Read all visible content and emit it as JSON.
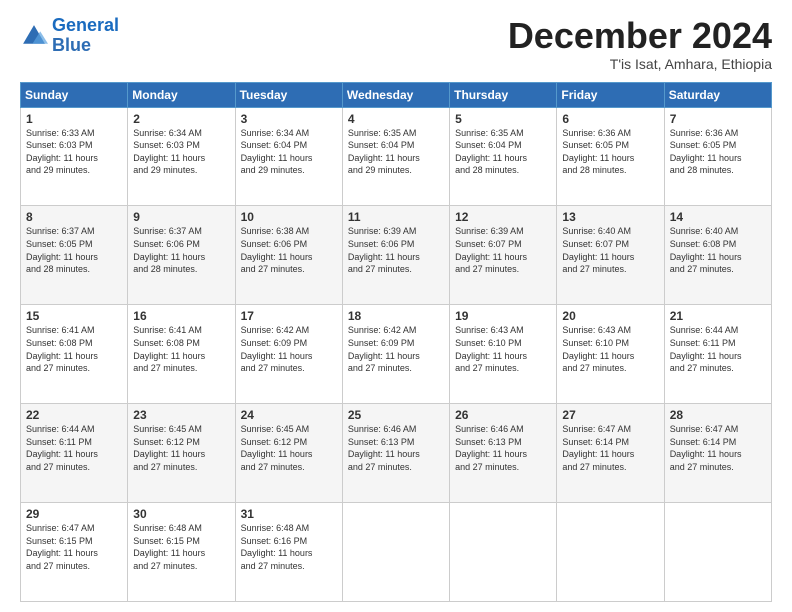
{
  "logo": {
    "line1": "General",
    "line2": "Blue"
  },
  "title": "December 2024",
  "subtitle": "T'is Isat, Amhara, Ethiopia",
  "days_of_week": [
    "Sunday",
    "Monday",
    "Tuesday",
    "Wednesday",
    "Thursday",
    "Friday",
    "Saturday"
  ],
  "weeks": [
    [
      {
        "day": "1",
        "rise": "6:33 AM",
        "set": "6:03 PM",
        "hours": "11",
        "mins": "29"
      },
      {
        "day": "2",
        "rise": "6:34 AM",
        "set": "6:03 PM",
        "hours": "11",
        "mins": "29"
      },
      {
        "day": "3",
        "rise": "6:34 AM",
        "set": "6:04 PM",
        "hours": "11",
        "mins": "29"
      },
      {
        "day": "4",
        "rise": "6:35 AM",
        "set": "6:04 PM",
        "hours": "11",
        "mins": "29"
      },
      {
        "day": "5",
        "rise": "6:35 AM",
        "set": "6:04 PM",
        "hours": "11",
        "mins": "28"
      },
      {
        "day": "6",
        "rise": "6:36 AM",
        "set": "6:05 PM",
        "hours": "11",
        "mins": "28"
      },
      {
        "day": "7",
        "rise": "6:36 AM",
        "set": "6:05 PM",
        "hours": "11",
        "mins": "28"
      }
    ],
    [
      {
        "day": "8",
        "rise": "6:37 AM",
        "set": "6:05 PM",
        "hours": "11",
        "mins": "28"
      },
      {
        "day": "9",
        "rise": "6:37 AM",
        "set": "6:06 PM",
        "hours": "11",
        "mins": "28"
      },
      {
        "day": "10",
        "rise": "6:38 AM",
        "set": "6:06 PM",
        "hours": "11",
        "mins": "27"
      },
      {
        "day": "11",
        "rise": "6:39 AM",
        "set": "6:06 PM",
        "hours": "11",
        "mins": "27"
      },
      {
        "day": "12",
        "rise": "6:39 AM",
        "set": "6:07 PM",
        "hours": "11",
        "mins": "27"
      },
      {
        "day": "13",
        "rise": "6:40 AM",
        "set": "6:07 PM",
        "hours": "11",
        "mins": "27"
      },
      {
        "day": "14",
        "rise": "6:40 AM",
        "set": "6:08 PM",
        "hours": "11",
        "mins": "27"
      }
    ],
    [
      {
        "day": "15",
        "rise": "6:41 AM",
        "set": "6:08 PM",
        "hours": "11",
        "mins": "27"
      },
      {
        "day": "16",
        "rise": "6:41 AM",
        "set": "6:08 PM",
        "hours": "11",
        "mins": "27"
      },
      {
        "day": "17",
        "rise": "6:42 AM",
        "set": "6:09 PM",
        "hours": "11",
        "mins": "27"
      },
      {
        "day": "18",
        "rise": "6:42 AM",
        "set": "6:09 PM",
        "hours": "11",
        "mins": "27"
      },
      {
        "day": "19",
        "rise": "6:43 AM",
        "set": "6:10 PM",
        "hours": "11",
        "mins": "27"
      },
      {
        "day": "20",
        "rise": "6:43 AM",
        "set": "6:10 PM",
        "hours": "11",
        "mins": "27"
      },
      {
        "day": "21",
        "rise": "6:44 AM",
        "set": "6:11 PM",
        "hours": "11",
        "mins": "27"
      }
    ],
    [
      {
        "day": "22",
        "rise": "6:44 AM",
        "set": "6:11 PM",
        "hours": "11",
        "mins": "27"
      },
      {
        "day": "23",
        "rise": "6:45 AM",
        "set": "6:12 PM",
        "hours": "11",
        "mins": "27"
      },
      {
        "day": "24",
        "rise": "6:45 AM",
        "set": "6:12 PM",
        "hours": "11",
        "mins": "27"
      },
      {
        "day": "25",
        "rise": "6:46 AM",
        "set": "6:13 PM",
        "hours": "11",
        "mins": "27"
      },
      {
        "day": "26",
        "rise": "6:46 AM",
        "set": "6:13 PM",
        "hours": "11",
        "mins": "27"
      },
      {
        "day": "27",
        "rise": "6:47 AM",
        "set": "6:14 PM",
        "hours": "11",
        "mins": "27"
      },
      {
        "day": "28",
        "rise": "6:47 AM",
        "set": "6:14 PM",
        "hours": "11",
        "mins": "27"
      }
    ],
    [
      {
        "day": "29",
        "rise": "6:47 AM",
        "set": "6:15 PM",
        "hours": "11",
        "mins": "27"
      },
      {
        "day": "30",
        "rise": "6:48 AM",
        "set": "6:15 PM",
        "hours": "11",
        "mins": "27"
      },
      {
        "day": "31",
        "rise": "6:48 AM",
        "set": "6:16 PM",
        "hours": "11",
        "mins": "27"
      },
      null,
      null,
      null,
      null
    ]
  ]
}
